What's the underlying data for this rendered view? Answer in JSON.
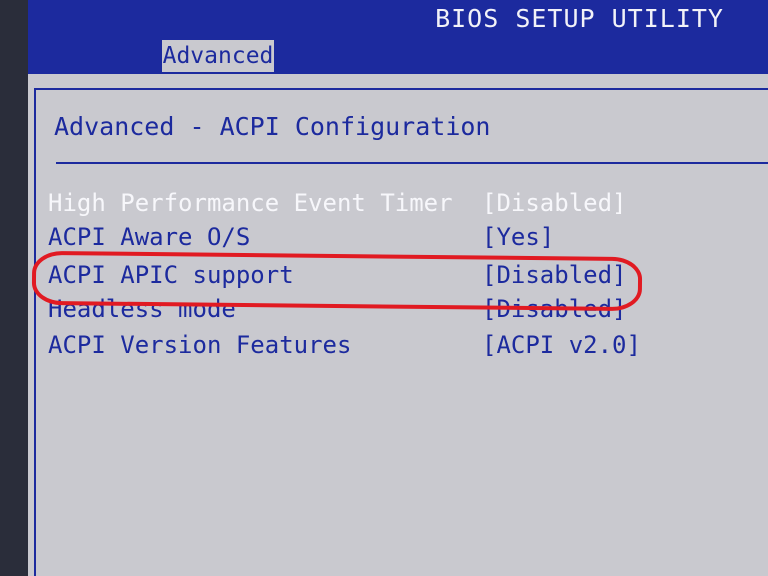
{
  "window": {
    "title": "BIOS SETUP UTILITY"
  },
  "tabs": [
    {
      "label": "Advanced",
      "active": true
    }
  ],
  "panel": {
    "title": "Advanced - ACPI Configuration"
  },
  "settings": [
    {
      "label": "High Performance Event Timer",
      "value": "[Disabled]",
      "highlighted": true
    },
    {
      "label": "ACPI Aware O/S",
      "value": "[Yes]",
      "highlighted": false
    },
    {
      "label": "ACPI APIC support",
      "value": "[Disabled]",
      "highlighted": false,
      "annotated": true
    },
    {
      "label": "Headless mode",
      "value": "[Disabled]",
      "highlighted": false
    },
    {
      "label": "ACPI Version Features",
      "value": "[ACPI v2.0]",
      "highlighted": false
    }
  ],
  "colors": {
    "bios_blue": "#1c2a9e",
    "background_gray": "#c9c9cf",
    "highlight_text": "#f7f7fb",
    "annotation_red": "#e11a22"
  }
}
